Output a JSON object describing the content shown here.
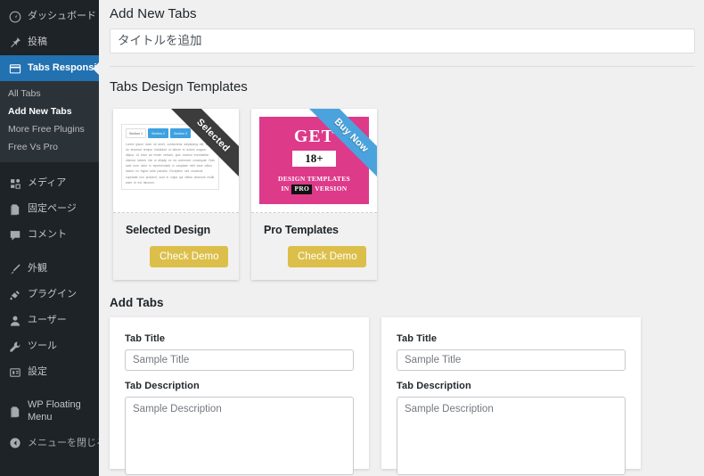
{
  "sidebar": {
    "items": [
      {
        "label": "ダッシュボード",
        "icon": "dashboard-icon",
        "id": "dashboard"
      },
      {
        "label": "投稿",
        "icon": "pin-icon",
        "id": "posts"
      },
      {
        "label": "Tabs Responsive",
        "icon": "tabs-icon",
        "id": "tabs-responsive",
        "active": true
      }
    ],
    "submenu": [
      {
        "label": "All Tabs",
        "id": "all-tabs"
      },
      {
        "label": "Add New Tabs",
        "id": "add-new-tabs",
        "current": true
      },
      {
        "label": "More Free Plugins",
        "id": "more-free-plugins"
      },
      {
        "label": "Free Vs Pro",
        "id": "free-vs-pro"
      }
    ],
    "items2": [
      {
        "label": "メディア",
        "icon": "media-icon",
        "id": "media"
      },
      {
        "label": "固定ページ",
        "icon": "page-icon",
        "id": "pages"
      },
      {
        "label": "コメント",
        "icon": "comment-icon",
        "id": "comments"
      }
    ],
    "items3": [
      {
        "label": "外観",
        "icon": "appearance-icon",
        "id": "appearance"
      },
      {
        "label": "プラグイン",
        "icon": "plugin-icon",
        "id": "plugins"
      },
      {
        "label": "ユーザー",
        "icon": "user-icon",
        "id": "users"
      },
      {
        "label": "ツール",
        "icon": "tools-icon",
        "id": "tools"
      },
      {
        "label": "設定",
        "icon": "settings-icon",
        "id": "settings"
      }
    ],
    "items4": [
      {
        "label": "WP Floating Menu",
        "icon": "page-icon",
        "id": "wp-floating-menu"
      }
    ],
    "collapse": {
      "label": "メニューを閉じる",
      "icon": "collapse-icon"
    }
  },
  "page": {
    "title": "Add New Tabs",
    "title_placeholder": "タイトルを追加",
    "title_value": ""
  },
  "templates": {
    "heading": "Tabs Design Templates",
    "cards": [
      {
        "name": "Selected Design",
        "button": "Check Demo",
        "ribbon": "Selected",
        "ribbon_color": "#3c3c3c",
        "preview": {
          "kind": "tabs-mock",
          "tabs": [
            "Section 1",
            "Section 2",
            "Section 3"
          ],
          "active_tabs": [
            1,
            2
          ],
          "body": "Lorem ipsum dolor sit amet, consectetur adipisicing elit, sed do eiusmod tempor incididunt ut labore et dolore magna aliqua. Ut enim ad minim veniam, quis nostrud exercitation ullamco laboris nisi ut aliquip ex ea commodo consequat. Duis aute irure dolor in reprehenderit in voluptate velit esse cillum dolore eu fugiat nulla pariatur. Excepteur sint occaecat cupidatat non proident, sunt in culpa qui officia deserunt mollit anim id est laborum."
        }
      },
      {
        "name": "Pro Templates",
        "button": "Check Demo",
        "ribbon": "Buy Now",
        "ribbon_color": "#4ba3dd",
        "preview": {
          "kind": "pro-art",
          "bg": "#dd3a8a",
          "get": "GET",
          "age": "18+",
          "line1": "DESIGN TEMPLATES",
          "line2_a": "IN",
          "line2_chip": "PRO",
          "line2_b": "VERSION"
        }
      }
    ]
  },
  "add_tabs": {
    "heading": "Add Tabs",
    "cards": [
      {
        "title_label": "Tab Title",
        "title_placeholder": "Sample Title",
        "title_value": "",
        "desc_label": "Tab Description",
        "desc_placeholder": "Sample Description",
        "desc_value": ""
      },
      {
        "title_label": "Tab Title",
        "title_placeholder": "Sample Title",
        "title_value": "",
        "desc_label": "Tab Description",
        "desc_placeholder": "Sample Description",
        "desc_value": ""
      }
    ]
  },
  "colors": {
    "sidebar_bg": "#1d2327",
    "submenu_bg": "#2c3338",
    "accent_blue": "#2271b1",
    "button_gold": "#dcbf4a",
    "pro_pink": "#dd3a8a",
    "ribbon_blue": "#4ba3dd",
    "content_bg": "#f0f0f1"
  }
}
